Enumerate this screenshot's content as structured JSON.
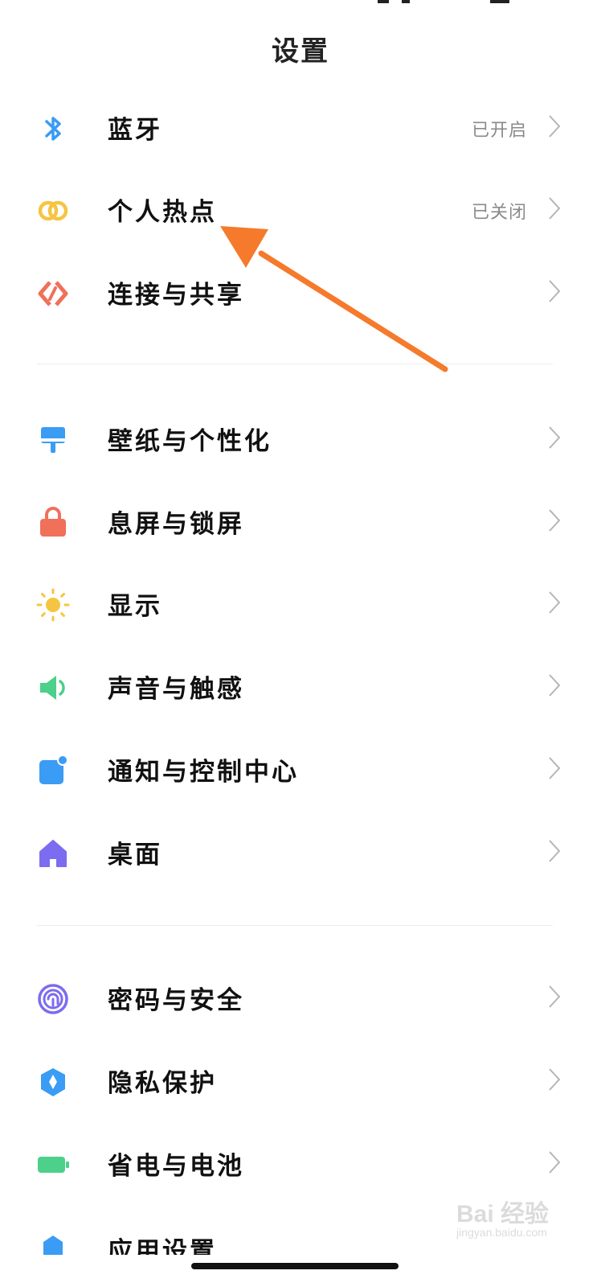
{
  "header": {
    "title": "设置"
  },
  "groups": [
    {
      "items": [
        {
          "label": "蓝牙",
          "status": "已开启",
          "icon": "bluetooth-icon",
          "color": "#3a9cf4"
        },
        {
          "label": "个人热点",
          "status": "已关闭",
          "icon": "hotspot-icon",
          "color": "#f5c542"
        },
        {
          "label": "连接与共享",
          "status": "",
          "icon": "connection-share-icon",
          "color": "#f0705a"
        }
      ]
    },
    {
      "items": [
        {
          "label": "壁纸与个性化",
          "status": "",
          "icon": "wallpaper-brush-icon",
          "color": "#3a9cf4"
        },
        {
          "label": "息屏与锁屏",
          "status": "",
          "icon": "lock-icon",
          "color": "#f0705a"
        },
        {
          "label": "显示",
          "status": "",
          "icon": "sun-icon",
          "color": "#f5c542"
        },
        {
          "label": "声音与触感",
          "status": "",
          "icon": "speaker-icon",
          "color": "#4cd08a"
        },
        {
          "label": "通知与控制中心",
          "status": "",
          "icon": "notification-icon",
          "color": "#3a9cf4"
        },
        {
          "label": "桌面",
          "status": "",
          "icon": "home-icon",
          "color": "#7b6cf0"
        }
      ]
    },
    {
      "items": [
        {
          "label": "密码与安全",
          "status": "",
          "icon": "fingerprint-icon",
          "color": "#7b6cf0"
        },
        {
          "label": "隐私保护",
          "status": "",
          "icon": "privacy-shield-icon",
          "color": "#3a9cf4"
        },
        {
          "label": "省电与电池",
          "status": "",
          "icon": "battery-icon",
          "color": "#4cd08a"
        }
      ]
    }
  ],
  "partial_item": {
    "label": "应用设置",
    "icon": "app-settings-icon",
    "color": "#3a9cf4"
  },
  "annotation": {
    "arrow_color": "#f57a2c"
  },
  "watermark": {
    "main": "Bai 经验",
    "sub": "jingyan.baidu.com"
  }
}
